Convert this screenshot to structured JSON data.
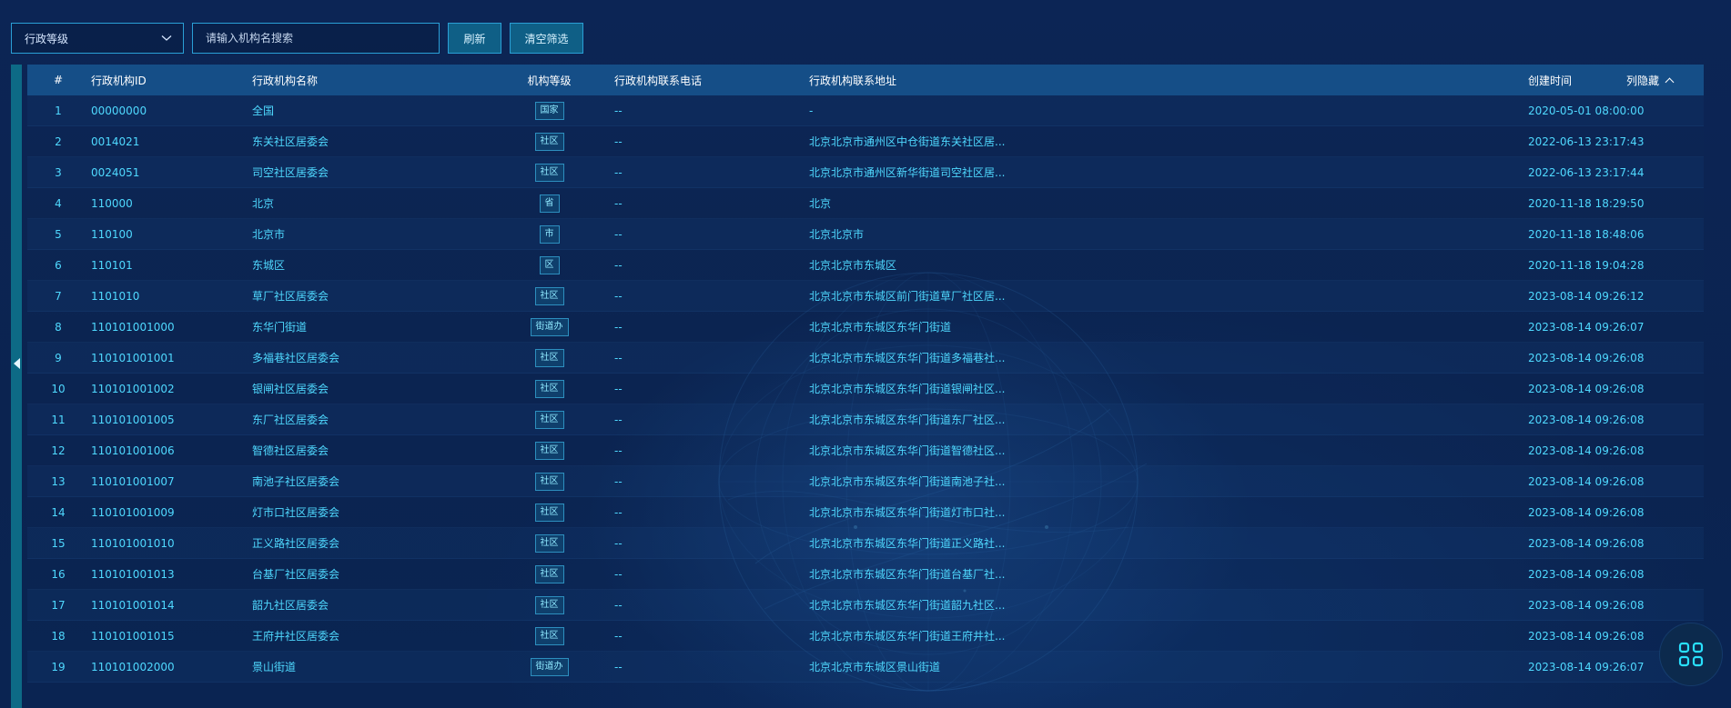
{
  "toolbar": {
    "level_select_value": "行政等级",
    "search_placeholder": "请输入机构名搜索",
    "refresh_label": "刷新",
    "clear_label": "清空筛选"
  },
  "table": {
    "headers": {
      "index": "#",
      "id": "行政机构ID",
      "name": "行政机构名称",
      "level": "机构等级",
      "phone": "行政机构联系电话",
      "address": "行政机构联系地址",
      "created": "创建时间"
    },
    "hide_columns_label": "列隐藏",
    "rows": [
      {
        "index": "1",
        "id": "00000000",
        "name": "全国",
        "level": "国家",
        "phone": "--",
        "address": "-",
        "created": "2020-05-01 08:00:00"
      },
      {
        "index": "2",
        "id": "0014021",
        "name": "东关社区居委会",
        "level": "社区",
        "phone": "--",
        "address": "北京北京市通州区中仓街道东关社区居...",
        "created": "2022-06-13 23:17:43"
      },
      {
        "index": "3",
        "id": "0024051",
        "name": "司空社区居委会",
        "level": "社区",
        "phone": "--",
        "address": "北京北京市通州区新华街道司空社区居...",
        "created": "2022-06-13 23:17:44"
      },
      {
        "index": "4",
        "id": "110000",
        "name": "北京",
        "level": "省",
        "phone": "--",
        "address": "北京",
        "created": "2020-11-18 18:29:50"
      },
      {
        "index": "5",
        "id": "110100",
        "name": "北京市",
        "level": "市",
        "phone": "--",
        "address": "北京北京市",
        "created": "2020-11-18 18:48:06"
      },
      {
        "index": "6",
        "id": "110101",
        "name": "东城区",
        "level": "区",
        "phone": "--",
        "address": "北京北京市东城区",
        "created": "2020-11-18 19:04:28"
      },
      {
        "index": "7",
        "id": "1101010",
        "name": "草厂社区居委会",
        "level": "社区",
        "phone": "--",
        "address": "北京北京市东城区前门街道草厂社区居...",
        "created": "2023-08-14 09:26:12"
      },
      {
        "index": "8",
        "id": "110101001000",
        "name": "东华门街道",
        "level": "街道办",
        "phone": "--",
        "address": "北京北京市东城区东华门街道",
        "created": "2023-08-14 09:26:07"
      },
      {
        "index": "9",
        "id": "110101001001",
        "name": "多福巷社区居委会",
        "level": "社区",
        "phone": "--",
        "address": "北京北京市东城区东华门街道多福巷社...",
        "created": "2023-08-14 09:26:08"
      },
      {
        "index": "10",
        "id": "110101001002",
        "name": "银闸社区居委会",
        "level": "社区",
        "phone": "--",
        "address": "北京北京市东城区东华门街道银闸社区...",
        "created": "2023-08-14 09:26:08"
      },
      {
        "index": "11",
        "id": "110101001005",
        "name": "东厂社区居委会",
        "level": "社区",
        "phone": "--",
        "address": "北京北京市东城区东华门街道东厂社区...",
        "created": "2023-08-14 09:26:08"
      },
      {
        "index": "12",
        "id": "110101001006",
        "name": "智德社区居委会",
        "level": "社区",
        "phone": "--",
        "address": "北京北京市东城区东华门街道智德社区...",
        "created": "2023-08-14 09:26:08"
      },
      {
        "index": "13",
        "id": "110101001007",
        "name": "南池子社区居委会",
        "level": "社区",
        "phone": "--",
        "address": "北京北京市东城区东华门街道南池子社...",
        "created": "2023-08-14 09:26:08"
      },
      {
        "index": "14",
        "id": "110101001009",
        "name": "灯市口社区居委会",
        "level": "社区",
        "phone": "--",
        "address": "北京北京市东城区东华门街道灯市口社...",
        "created": "2023-08-14 09:26:08"
      },
      {
        "index": "15",
        "id": "110101001010",
        "name": "正义路社区居委会",
        "level": "社区",
        "phone": "--",
        "address": "北京北京市东城区东华门街道正义路社...",
        "created": "2023-08-14 09:26:08"
      },
      {
        "index": "16",
        "id": "110101001013",
        "name": "台基厂社区居委会",
        "level": "社区",
        "phone": "--",
        "address": "北京北京市东城区东华门街道台基厂社...",
        "created": "2023-08-14 09:26:08"
      },
      {
        "index": "17",
        "id": "110101001014",
        "name": "韶九社区居委会",
        "level": "社区",
        "phone": "--",
        "address": "北京北京市东城区东华门街道韶九社区...",
        "created": "2023-08-14 09:26:08"
      },
      {
        "index": "18",
        "id": "110101001015",
        "name": "王府井社区居委会",
        "level": "社区",
        "phone": "--",
        "address": "北京北京市东城区东华门街道王府井社...",
        "created": "2023-08-14 09:26:08"
      },
      {
        "index": "19",
        "id": "110101002000",
        "name": "景山街道",
        "level": "街道办",
        "phone": "--",
        "address": "北京北京市东城区景山街道",
        "created": "2023-08-14 09:26:07"
      }
    ]
  },
  "icons": {
    "select_caret": "chevron-down-icon",
    "collapse": "caret-left-icon",
    "hide_columns": "chevron-up-icon",
    "fab": "grid-apps-icon"
  },
  "colors": {
    "background": "#0b2350",
    "header_bg": "#154e87",
    "cell_text": "#4fd9ff",
    "accent_border": "#2a9fd6",
    "button_bg": "#0f5f86",
    "side_bar": "#0d6a86",
    "fab_icon": "#29e0ff"
  }
}
